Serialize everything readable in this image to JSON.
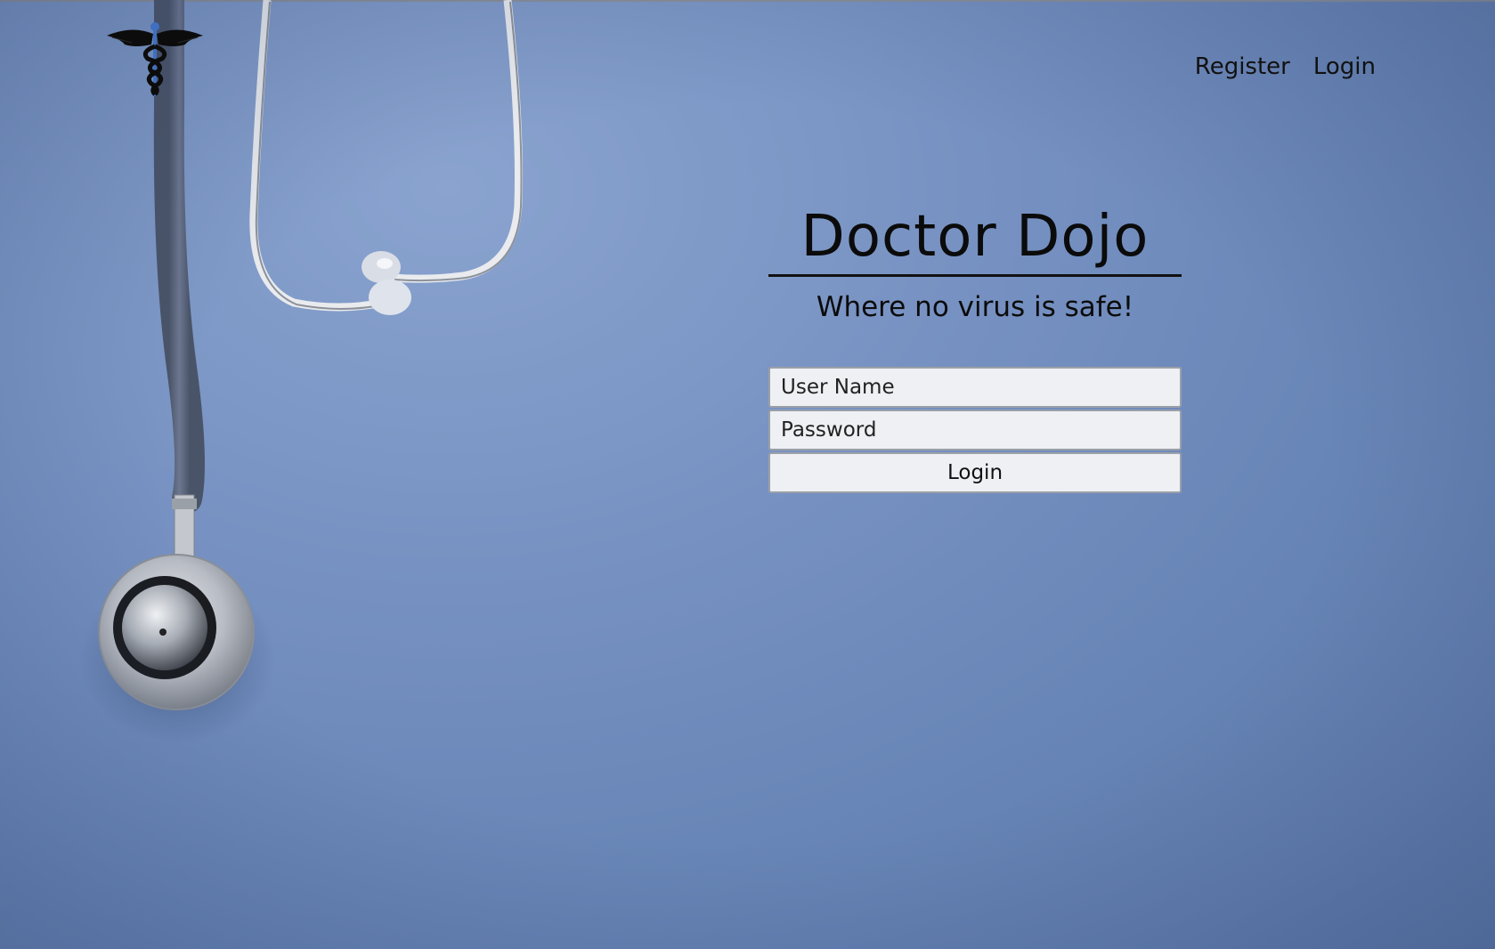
{
  "nav": {
    "register_label": "Register",
    "login_label": "Login"
  },
  "hero": {
    "title": "Doctor Dojo",
    "subtitle": "Where no virus is safe!"
  },
  "login_form": {
    "username_placeholder": "User Name",
    "username_value": "",
    "password_placeholder": "Password",
    "password_value": "",
    "submit_label": "Login"
  },
  "icons": {
    "logo": "caduceus-icon",
    "background": "stethoscope-photo"
  },
  "colors": {
    "background": "#7792c2",
    "text": "#111111",
    "field_background": "#eef0f3",
    "field_border": "#9aa0a8",
    "logo_accent": "#3f6fc0"
  }
}
